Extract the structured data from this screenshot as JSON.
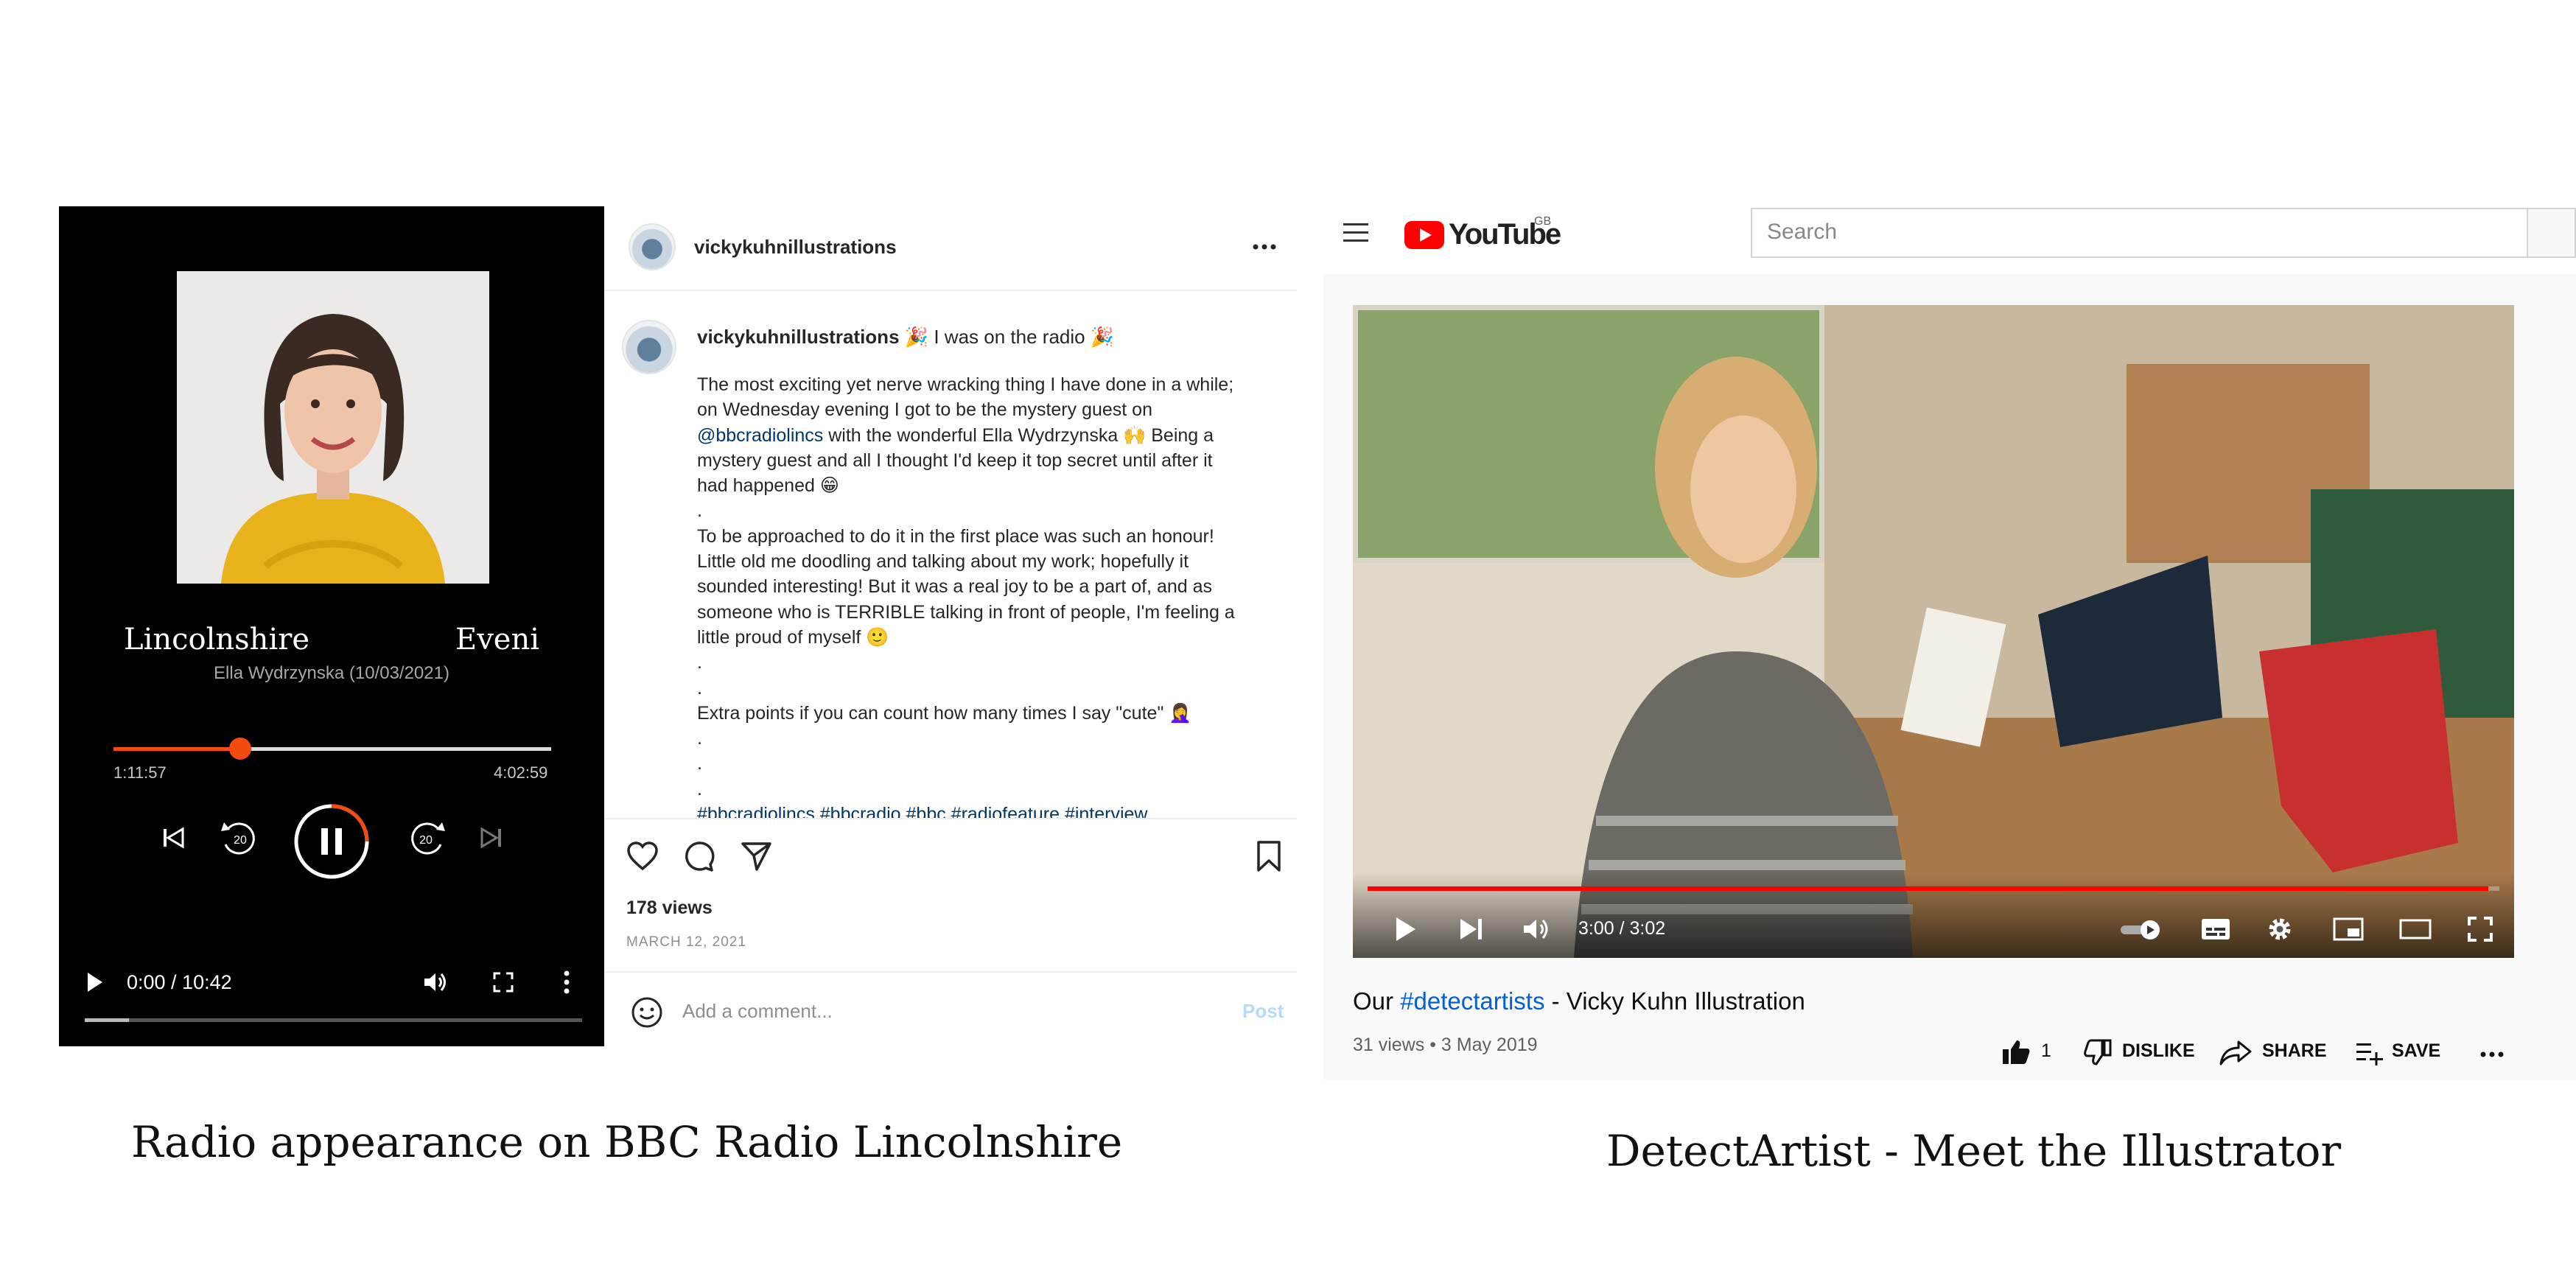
{
  "radio": {
    "show_left": "Lincolnshire",
    "show_right": "Eveni",
    "episode": "Ella Wydrzynska (10/03/2021)",
    "elapsed": "1:11:57",
    "duration": "4:02:59",
    "progress": 0.29,
    "skip_seconds": "20",
    "html5_time": "0:00 / 10:42",
    "caption": "Radio appearance on BBC Radio Lincolnshire"
  },
  "instagram": {
    "username": "vickykuhnillustrations",
    "headline": "🎉 I was on the radio 🎉",
    "caption_lines": [
      "The most exciting yet nerve wracking thing I have done in a while;",
      "on Wednesday evening I got to be the mystery guest on",
      "@bbcradiolincs",
      " with the wonderful Ella Wydrzynska 🙌 Being a",
      "mystery guest and all I thought I'd keep it top secret until after it",
      "had happened 😁",
      ".",
      "To be approached to do it in the first place was such an honour!",
      "Little old me doodling and talking about my work; hopefully it",
      "sounded interesting! But it was a real joy to be a part of, and as",
      "someone who is TERRIBLE talking in front of people, I'm feeling a",
      "little proud of myself 🙂",
      ".",
      ".",
      "Extra points if you can count how many times I say \"cute\" 🤦‍♀️",
      ".",
      ".",
      ".",
      "#bbcradiolincs #bbcradio #bbc #radiofeature #interview"
    ],
    "views": "178 views",
    "date": "MARCH 12, 2021",
    "comment_placeholder": "Add a comment...",
    "post_label": "Post"
  },
  "youtube": {
    "logo_text": "YouTube",
    "region": "GB",
    "search_placeholder": "Search",
    "time": "3:00 / 3:02",
    "progress": 0.99,
    "title_prefix": "Our ",
    "title_tag": "#detectartists",
    "title_suffix": " - Vicky Kuhn Illustration",
    "meta": "31 views • 3 May 2019",
    "likes": "1",
    "dislike_label": "DISLIKE",
    "share_label": "SHARE",
    "save_label": "SAVE",
    "caption": "DetectArtist - Meet the Illustrator"
  },
  "colors": {
    "bbc_accent": "#f54b0f",
    "youtube_red": "#ff0000",
    "instagram_link": "#00376b",
    "youtube_link": "#065fd4"
  }
}
